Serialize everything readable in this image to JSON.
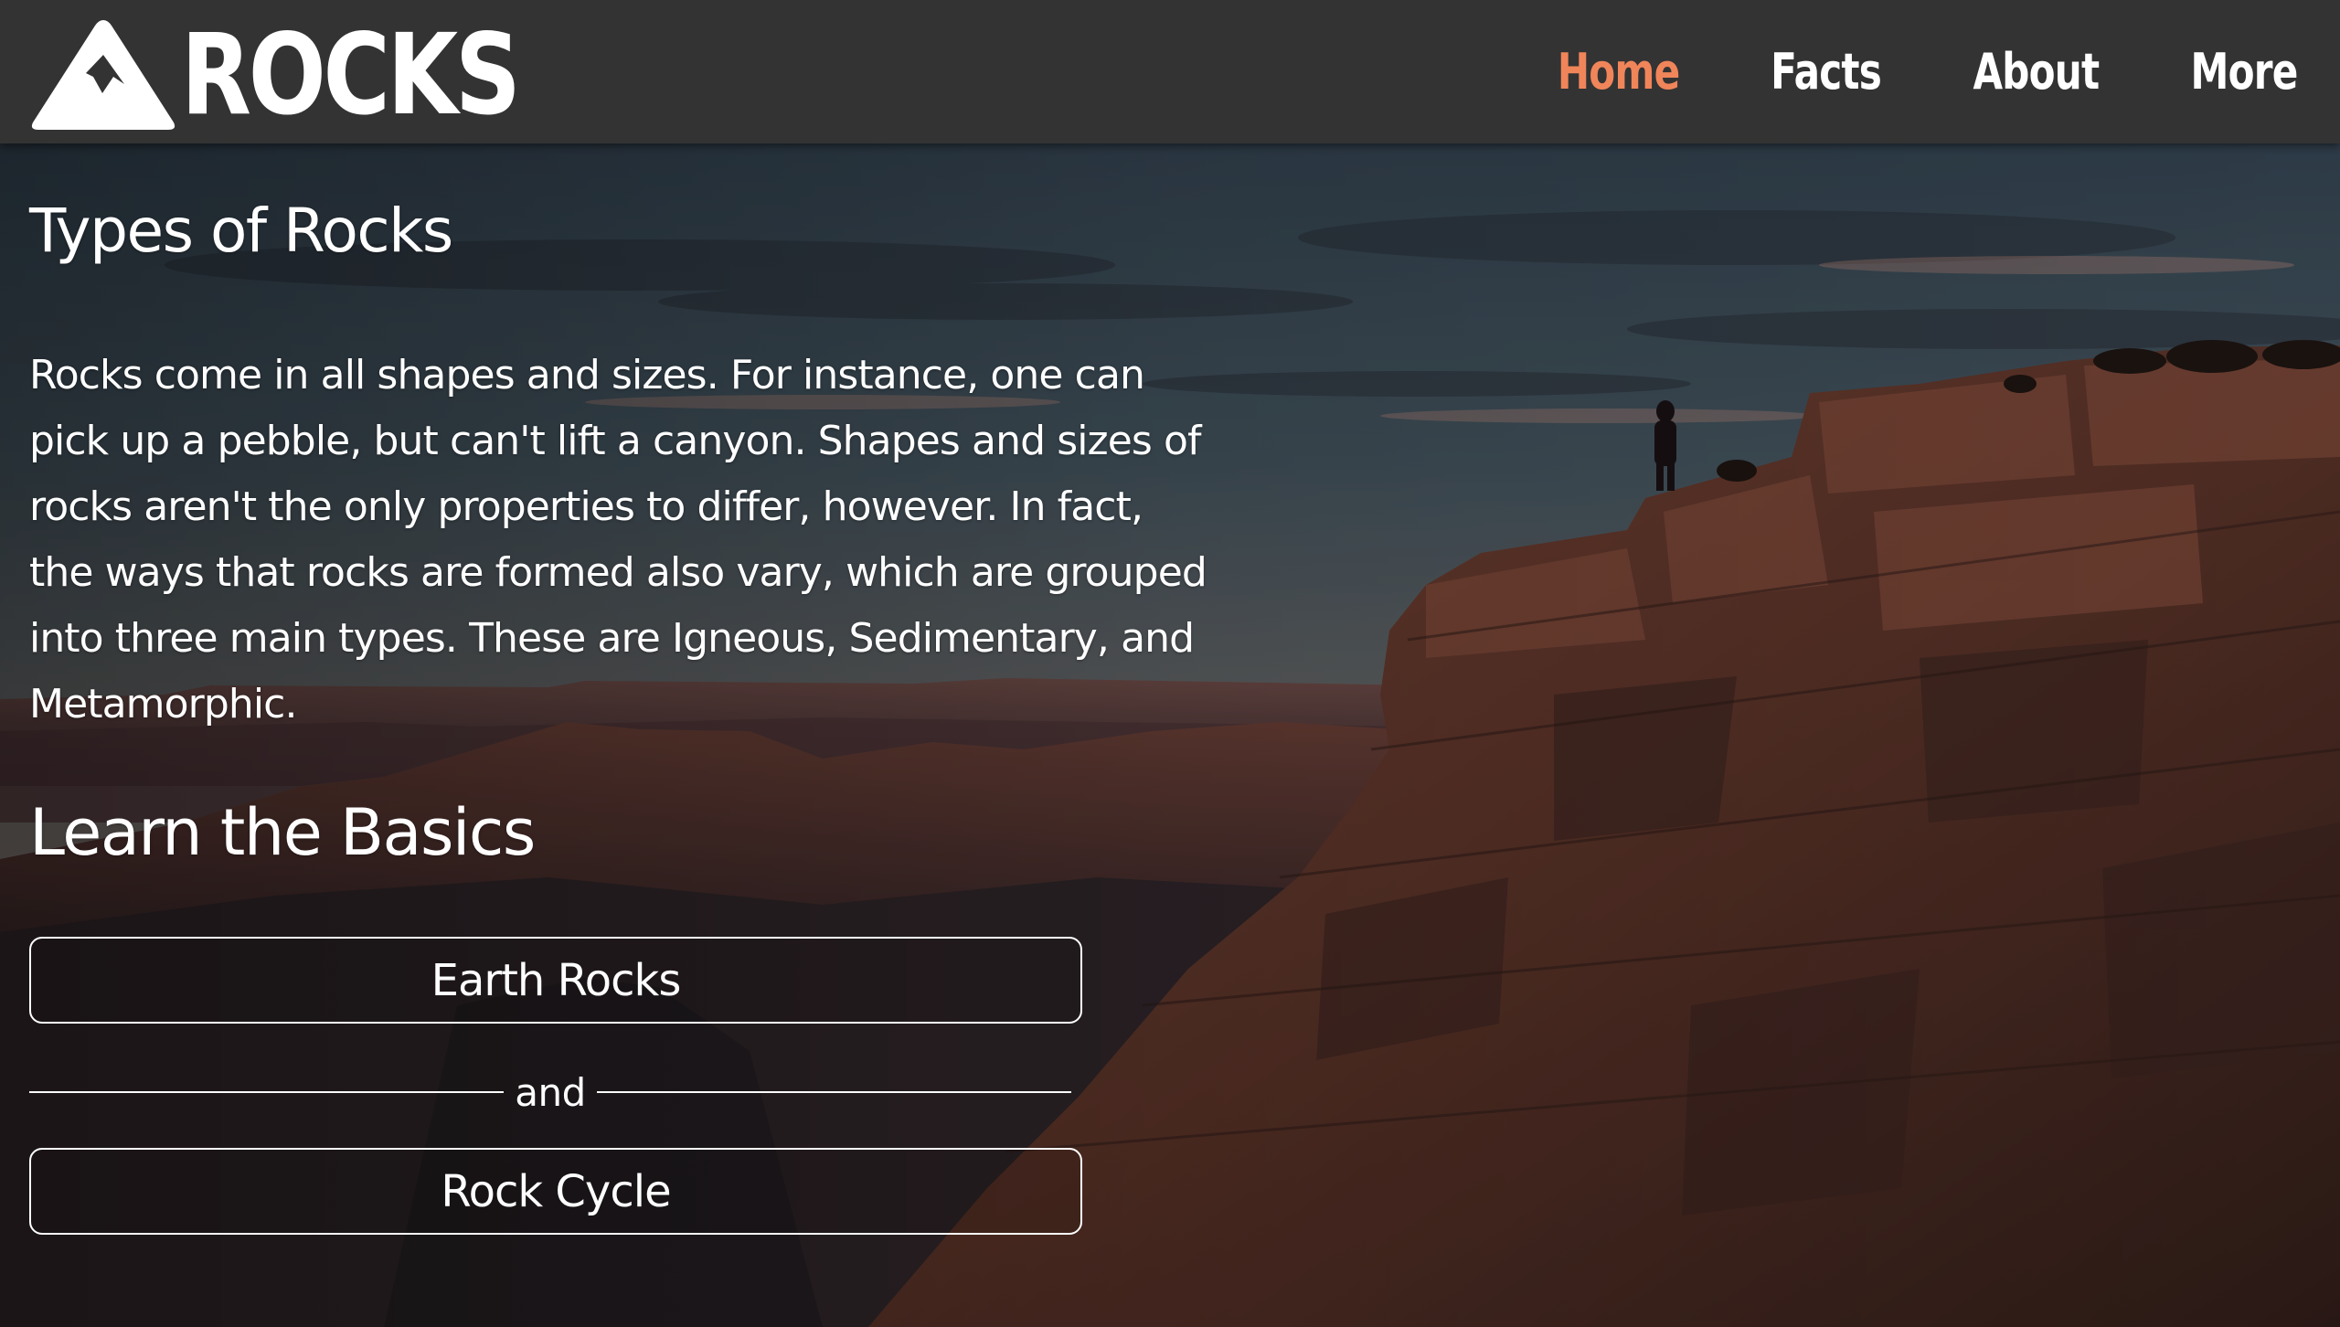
{
  "brand": {
    "name": "ROCKS",
    "logo_icon": "mountain-icon"
  },
  "nav": {
    "items": [
      {
        "label": "Home",
        "active": true
      },
      {
        "label": "Facts",
        "active": false
      },
      {
        "label": "About",
        "active": false
      },
      {
        "label": "More",
        "active": false
      }
    ]
  },
  "types": {
    "title": "Types of Rocks",
    "body": "Rocks come in all shapes and sizes. For instance, one can pick up a pebble, but can't lift a canyon. Shapes and sizes of rocks aren't the only properties to differ, however. In fact, the ways that rocks are formed also vary, which are grouped into three main types. These are Igneous, Sedimentary, and Metamorphic."
  },
  "basics": {
    "title": "Learn the Basics",
    "button_1": "Earth Rocks",
    "divider_text": "and",
    "button_2": "Rock Cycle"
  },
  "colors": {
    "navbar": "#333333",
    "accent": "#f0855a",
    "text": "#ffffff"
  }
}
